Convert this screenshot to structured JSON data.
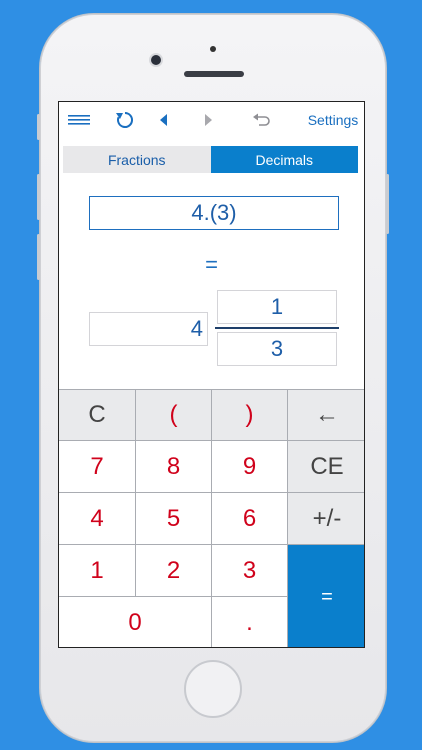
{
  "toolbar": {
    "settings_label": "Settings",
    "icons": [
      "menu-icon",
      "refresh-icon",
      "back-icon",
      "forward-icon",
      "undo-icon"
    ],
    "accent": "#1a6fc0"
  },
  "tabs": [
    {
      "label": "Fractions",
      "active": false
    },
    {
      "label": "Decimals",
      "active": true
    }
  ],
  "converter": {
    "decimal_value": "4.(3)",
    "equals": "=",
    "whole": "4",
    "numerator": "1",
    "denominator": "3"
  },
  "keypad": {
    "clear": "C",
    "open_paren": "(",
    "close_paren": ")",
    "backspace": "←",
    "k7": "7",
    "k8": "8",
    "k9": "9",
    "ce": "CE",
    "k4": "4",
    "k5": "5",
    "k6": "6",
    "sign": "+/-",
    "k1": "1",
    "k2": "2",
    "k3": "3",
    "equals": "=",
    "k0": "0",
    "dot": "."
  },
  "colors": {
    "background": "#2f8fe4",
    "tab_active": "#0a7fcc",
    "digit": "#d0021b",
    "equals_key": "#0a7fcc"
  }
}
